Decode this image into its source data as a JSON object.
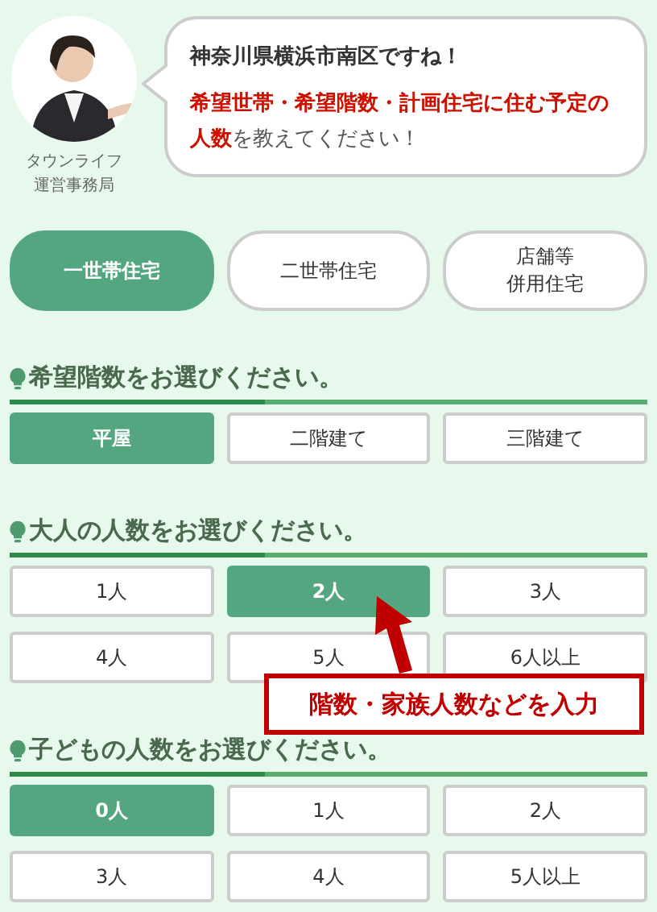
{
  "operator": {
    "photo": {
      "kind": "picture"
    },
    "caption": [
      "タウンライフ",
      "運営事務局"
    ]
  },
  "bubble": {
    "lines": [
      "神奈川県横浜市南区ですね！",
      "**希望世帯・希望階数・計画住宅に住む予定の人数**を教えてください！"
    ]
  },
  "household_types": [
    {
      "lines": [
        "一世帯住宅"
      ],
      "selected": true
    },
    {
      "lines": [
        "二世帯住宅"
      ],
      "selected": false
    },
    {
      "lines": [
        "店舗等",
        "併用住宅"
      ],
      "selected": false
    }
  ],
  "sections": [
    {
      "title": "希望階数をお選びください。",
      "options": [
        {
          "label": "平屋",
          "selected": true
        },
        {
          "label": "二階建て",
          "selected": false
        },
        {
          "label": "三階建て",
          "selected": false
        }
      ]
    },
    {
      "title": "大人の人数をお選びください。",
      "options": [
        {
          "label": "1人",
          "selected": false
        },
        {
          "label": "2人",
          "selected": true
        },
        {
          "label": "3人",
          "selected": false
        },
        {
          "label": "4人",
          "selected": false
        },
        {
          "label": "5人",
          "selected": false
        },
        {
          "label": "6人以上",
          "selected": false
        }
      ]
    },
    {
      "title": "子どもの人数をお選びください。",
      "options": [
        {
          "label": "0人",
          "selected": true
        },
        {
          "label": "1人",
          "selected": false
        },
        {
          "label": "2人",
          "selected": false
        },
        {
          "label": "3人",
          "selected": false
        },
        {
          "label": "4人",
          "selected": false
        },
        {
          "label": "5人以上",
          "selected": false
        }
      ]
    }
  ],
  "callout": {
    "text": "階数・家族人数などを入力"
  }
}
